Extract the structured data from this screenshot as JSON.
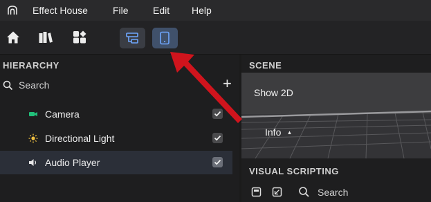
{
  "menubar": {
    "app_name": "Effect House",
    "items": [
      "File",
      "Edit",
      "Help"
    ]
  },
  "toolbar": {
    "icons": [
      "home-icon",
      "library-icon",
      "assets-icon",
      "layout-toggle-icon",
      "mobile-preview-icon"
    ]
  },
  "hierarchy": {
    "title": "HIERARCHY",
    "search_label": "Search",
    "add_label": "+",
    "items": [
      {
        "label": "Camera",
        "icon": "camera-icon",
        "checked": true,
        "selected": false
      },
      {
        "label": "Directional Light",
        "icon": "light-icon",
        "checked": true,
        "selected": false
      },
      {
        "label": "Audio Player",
        "icon": "speaker-icon",
        "checked": true,
        "selected": true
      }
    ]
  },
  "scene": {
    "title": "SCENE",
    "show2d_label": "Show 2D",
    "info_label": "Info",
    "info_caret": "▴"
  },
  "visual_scripting": {
    "title": "VISUAL SCRIPTING",
    "search_label": "Search"
  },
  "colors": {
    "accent_blue": "#6fa8ff",
    "camera_icon": "#21c07a",
    "light_icon": "#f0c040",
    "annotation_arrow": "#d0141d"
  }
}
